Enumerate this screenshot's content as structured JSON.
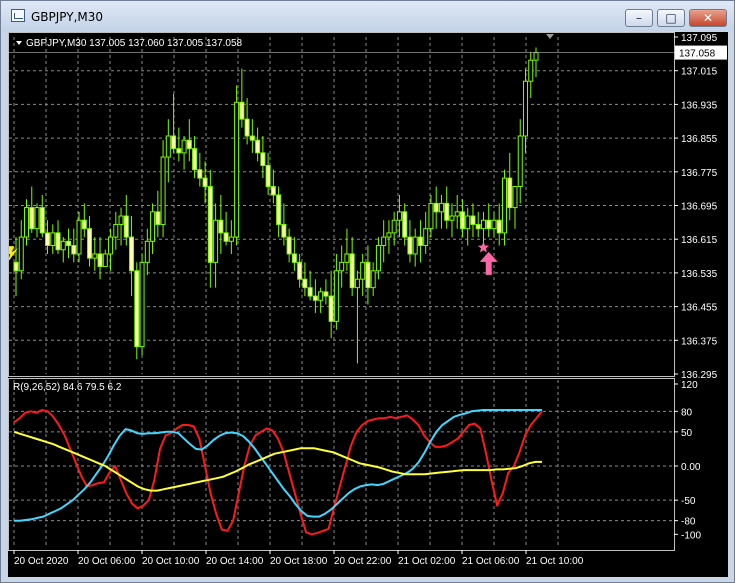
{
  "window": {
    "title": "GBPJPY,M30",
    "minimize_label": "–",
    "maximize_label": "□",
    "close_label": "✕"
  },
  "colors": {
    "background": "#000000",
    "grid": "#8a8a8a",
    "candle": "#7cfc00",
    "candle_body_up": "#000000",
    "candle_body_down": "#ffffaa",
    "axis_text": "#ffffff",
    "price_box": "#ffffff",
    "line_red": "#ff1a1a",
    "line_cyan": "#40d8ff",
    "line_yellow": "#ffff33",
    "signal_up_arrow": "#ff66aa",
    "signal_left": "#ffee00"
  },
  "icons": {
    "app": "chart-window-icon",
    "up_arrow": "buy-arrow-icon",
    "star": "star-icon"
  },
  "chart_data": [
    {
      "type": "candlestick",
      "info_label": "GBPJPY,M30  137.005 137.060 137.005 137.058",
      "ohlc_values": [
        137.005,
        137.06,
        137.005,
        137.058
      ],
      "current_price_label": "137.058",
      "current_price": 137.058,
      "ylim": [
        136.295,
        137.095
      ],
      "yticks": [
        "137.095",
        "137.015",
        "136.935",
        "136.855",
        "136.775",
        "136.695",
        "136.615",
        "136.535",
        "136.455",
        "136.375",
        "136.295"
      ],
      "xticks": [
        "20 Oct 2020",
        "20 Oct 06:00",
        "20 Oct 10:00",
        "20 Oct 14:00",
        "20 Oct 18:00",
        "20 Oct 22:00",
        "21 Oct 02:00",
        "21 Oct 06:00",
        "21 Oct 10:00"
      ],
      "grid": true,
      "candles": [
        [
          136.56,
          136.62,
          136.48,
          136.54
        ],
        [
          136.54,
          136.66,
          136.52,
          136.62
        ],
        [
          136.62,
          136.71,
          136.6,
          136.69
        ],
        [
          136.69,
          136.74,
          136.63,
          136.64
        ],
        [
          136.64,
          136.7,
          136.62,
          136.69
        ],
        [
          136.69,
          136.72,
          136.62,
          136.63
        ],
        [
          136.63,
          136.66,
          136.58,
          136.6
        ],
        [
          136.6,
          136.65,
          136.58,
          136.63
        ],
        [
          136.63,
          136.66,
          136.58,
          136.59
        ],
        [
          136.59,
          136.62,
          136.56,
          136.61
        ],
        [
          136.61,
          136.64,
          136.57,
          136.6
        ],
        [
          136.6,
          136.64,
          136.56,
          136.58
        ],
        [
          136.58,
          136.68,
          136.56,
          136.66
        ],
        [
          136.66,
          136.7,
          136.62,
          136.64
        ],
        [
          136.64,
          136.67,
          136.55,
          136.57
        ],
        [
          136.57,
          136.62,
          136.54,
          136.58
        ],
        [
          136.58,
          136.62,
          136.52,
          136.55
        ],
        [
          136.55,
          136.59,
          136.55,
          136.58
        ],
        [
          136.58,
          136.64,
          136.54,
          136.62
        ],
        [
          136.62,
          136.68,
          136.59,
          136.65
        ],
        [
          136.65,
          136.69,
          136.6,
          136.67
        ],
        [
          136.67,
          136.72,
          136.6,
          136.62
        ],
        [
          136.62,
          136.67,
          136.48,
          136.54
        ],
        [
          136.54,
          136.56,
          136.33,
          136.36
        ],
        [
          136.36,
          136.58,
          136.34,
          136.56
        ],
        [
          136.56,
          136.64,
          136.53,
          136.61
        ],
        [
          136.61,
          136.7,
          136.58,
          136.68
        ],
        [
          136.68,
          136.73,
          136.62,
          136.65
        ],
        [
          136.65,
          136.85,
          136.62,
          136.81
        ],
        [
          136.81,
          136.9,
          136.75,
          136.86
        ],
        [
          136.86,
          136.96,
          136.82,
          136.83
        ],
        [
          136.83,
          136.88,
          136.8,
          136.82
        ],
        [
          136.82,
          136.86,
          136.78,
          136.85
        ],
        [
          136.85,
          136.9,
          136.8,
          136.83
        ],
        [
          136.83,
          136.86,
          136.76,
          136.78
        ],
        [
          136.78,
          136.82,
          136.74,
          136.76
        ],
        [
          136.76,
          136.8,
          136.7,
          136.74
        ],
        [
          136.74,
          136.78,
          136.5,
          136.56
        ],
        [
          136.56,
          136.7,
          136.5,
          136.66
        ],
        [
          136.66,
          136.72,
          136.58,
          136.63
        ],
        [
          136.63,
          136.68,
          136.6,
          136.61
        ],
        [
          136.61,
          136.66,
          136.58,
          136.62
        ],
        [
          136.62,
          136.98,
          136.6,
          136.94
        ],
        [
          136.94,
          137.02,
          136.88,
          136.9
        ],
        [
          136.9,
          136.95,
          136.84,
          136.86
        ],
        [
          136.86,
          136.9,
          136.82,
          136.85
        ],
        [
          136.85,
          136.88,
          136.8,
          136.82
        ],
        [
          136.82,
          136.86,
          136.76,
          136.79
        ],
        [
          136.79,
          136.82,
          136.72,
          136.74
        ],
        [
          136.74,
          136.78,
          136.7,
          136.72
        ],
        [
          136.72,
          136.74,
          136.62,
          136.65
        ],
        [
          136.65,
          136.7,
          136.6,
          136.62
        ],
        [
          136.62,
          136.64,
          136.56,
          136.58
        ],
        [
          136.58,
          136.62,
          136.54,
          136.56
        ],
        [
          136.56,
          136.58,
          136.5,
          136.52
        ],
        [
          136.52,
          136.56,
          136.48,
          136.5
        ],
        [
          136.5,
          136.54,
          136.47,
          136.48
        ],
        [
          136.48,
          136.52,
          136.44,
          136.47
        ],
        [
          136.47,
          136.5,
          136.44,
          136.49
        ],
        [
          136.49,
          136.52,
          136.46,
          136.48
        ],
        [
          136.48,
          136.54,
          136.38,
          136.42
        ],
        [
          136.42,
          136.58,
          136.4,
          136.54
        ],
        [
          136.54,
          136.6,
          136.5,
          136.56
        ],
        [
          136.56,
          136.64,
          136.54,
          136.58
        ],
        [
          136.58,
          136.62,
          136.48,
          136.5
        ],
        [
          136.5,
          136.54,
          136.32,
          136.52
        ],
        [
          136.52,
          136.58,
          136.48,
          136.56
        ],
        [
          136.56,
          136.6,
          136.46,
          136.5
        ],
        [
          136.5,
          136.56,
          136.48,
          136.54
        ],
        [
          136.54,
          136.62,
          136.52,
          136.6
        ],
        [
          136.6,
          136.66,
          136.56,
          136.62
        ],
        [
          136.62,
          136.66,
          136.58,
          136.63
        ],
        [
          136.63,
          136.68,
          136.6,
          136.66
        ],
        [
          136.66,
          136.72,
          136.62,
          136.68
        ],
        [
          136.68,
          136.7,
          136.6,
          136.62
        ],
        [
          136.62,
          136.66,
          136.56,
          136.58
        ],
        [
          136.58,
          136.64,
          136.55,
          136.62
        ],
        [
          136.62,
          136.66,
          136.56,
          136.6
        ],
        [
          136.6,
          136.68,
          136.58,
          136.64
        ],
        [
          136.64,
          136.72,
          136.62,
          136.7
        ],
        [
          136.7,
          136.74,
          136.64,
          136.68
        ],
        [
          136.68,
          136.72,
          136.64,
          136.7
        ],
        [
          136.7,
          136.74,
          136.64,
          136.66
        ],
        [
          136.66,
          136.7,
          136.62,
          136.67
        ],
        [
          136.67,
          136.72,
          136.64,
          136.68
        ],
        [
          136.68,
          136.71,
          136.62,
          136.64
        ],
        [
          136.64,
          136.69,
          136.6,
          136.67
        ],
        [
          136.67,
          136.7,
          136.62,
          136.65
        ],
        [
          136.65,
          136.68,
          136.62,
          136.64
        ],
        [
          136.64,
          136.68,
          136.6,
          136.66
        ],
        [
          136.66,
          136.7,
          136.62,
          136.64
        ],
        [
          136.64,
          136.68,
          136.62,
          136.66
        ],
        [
          136.66,
          136.7,
          136.6,
          136.63
        ],
        [
          136.63,
          136.78,
          136.6,
          136.76
        ],
        [
          136.76,
          136.82,
          136.66,
          136.69
        ],
        [
          136.69,
          136.72,
          136.64,
          136.74
        ],
        [
          136.74,
          136.9,
          136.7,
          136.86
        ],
        [
          136.86,
          137.02,
          136.82,
          136.99
        ],
        [
          136.99,
          137.06,
          136.95,
          137.04
        ],
        [
          137.04,
          137.07,
          137.0,
          137.058
        ]
      ],
      "signals": [
        {
          "kind": "buy-arrow",
          "candle_index": 90
        },
        {
          "kind": "star",
          "candle_index": 89
        },
        {
          "kind": "left-marker",
          "candle_index": 0
        }
      ]
    },
    {
      "type": "line",
      "info_label": "R(9,26,52) 84.6 79.5 6.2",
      "ylim": [
        -120,
        120
      ],
      "yticks": [
        "120",
        "80",
        "50",
        "0.00",
        "-50",
        "-80",
        "-100"
      ],
      "ytick_values": [
        120,
        80,
        50,
        0,
        -50,
        -80,
        -100
      ],
      "series": [
        {
          "name": "",
          "color_key": "line_red",
          "values": [
            64,
            70,
            78,
            80,
            78,
            82,
            80,
            72,
            60,
            45,
            25,
            5,
            -15,
            -30,
            -28,
            -25,
            -24,
            -10,
            0,
            -20,
            -40,
            -55,
            -62,
            -58,
            -50,
            -20,
            25,
            45,
            48,
            55,
            60,
            60,
            58,
            40,
            0,
            -40,
            -70,
            -93,
            -95,
            -80,
            -40,
            0,
            30,
            45,
            50,
            55,
            52,
            40,
            20,
            -10,
            -40,
            -70,
            -97,
            -100,
            -98,
            -95,
            -92,
            -60,
            -30,
            0,
            30,
            50,
            60,
            66,
            68,
            70,
            70,
            72,
            70,
            72,
            74,
            68,
            60,
            45,
            35,
            28,
            28,
            30,
            35,
            40,
            50,
            60,
            62,
            55,
            20,
            -20,
            -58,
            -40,
            -10,
            0,
            20,
            45,
            60,
            70,
            80
          ]
        },
        {
          "name": "",
          "color_key": "line_cyan",
          "values": [
            -80,
            -80,
            -79,
            -78,
            -76,
            -74,
            -70,
            -66,
            -62,
            -56,
            -50,
            -42,
            -34,
            -24,
            -12,
            0,
            14,
            30,
            44,
            54,
            52,
            48,
            47,
            48,
            48,
            49,
            50,
            50,
            48,
            40,
            32,
            25,
            24,
            30,
            38,
            44,
            48,
            49,
            48,
            44,
            36,
            26,
            14,
            2,
            -10,
            -22,
            -34,
            -44,
            -56,
            -66,
            -73,
            -74,
            -74,
            -70,
            -64,
            -56,
            -48,
            -40,
            -34,
            -30,
            -28,
            -27,
            -28,
            -26,
            -22,
            -18,
            -14,
            -10,
            -4,
            6,
            20,
            36,
            50,
            60,
            66,
            72,
            75,
            77,
            80,
            81,
            82,
            82,
            82,
            82,
            82,
            82,
            82,
            82,
            82,
            82,
            82
          ]
        },
        {
          "name": "",
          "color_key": "line_yellow",
          "values": [
            50,
            47,
            44,
            41,
            38,
            35,
            32,
            28,
            24,
            20,
            16,
            12,
            8,
            4,
            0,
            -6,
            -12,
            -18,
            -24,
            -30,
            -34,
            -36,
            -36,
            -34,
            -32,
            -30,
            -28,
            -26,
            -24,
            -22,
            -20,
            -18,
            -16,
            -12,
            -8,
            -3,
            2,
            6,
            10,
            14,
            18,
            20,
            22,
            24,
            26,
            26,
            26,
            24,
            22,
            20,
            16,
            12,
            8,
            4,
            2,
            0,
            -2,
            -5,
            -8,
            -10,
            -12,
            -12,
            -12,
            -12,
            -11,
            -10,
            -9,
            -8,
            -7,
            -6,
            -6,
            -6,
            -6,
            -6,
            -5,
            -5,
            -4,
            -3,
            0,
            4,
            6,
            6
          ]
        }
      ]
    }
  ]
}
